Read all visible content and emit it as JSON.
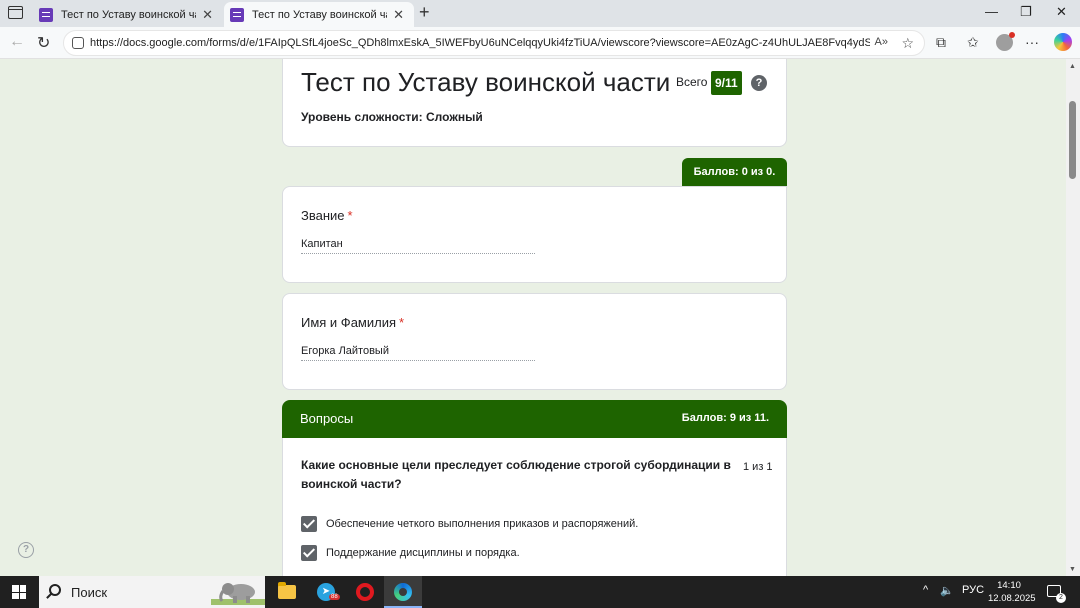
{
  "browser": {
    "tabs": [
      {
        "title": "Тест по Уставу воинской части",
        "active": false
      },
      {
        "title": "Тест по Уставу воинской части",
        "active": true
      }
    ],
    "url": "https://docs.google.com/forms/d/e/1FAIpQLSfL4joeSc_QDh8lmxEskA_5IWEFbyU6uNCelqqyUki4fzTiUA/viewscore?viewscore=AE0zAgC-z4UhULJAE8Fvq4ydSH...",
    "icons": [
      "window-menu-icon",
      "form-icon",
      "close-icon",
      "plus-icon",
      "back-icon",
      "refresh-icon",
      "lock-icon",
      "read-aloud-icon",
      "star-icon",
      "extensions-icon",
      "favorites-icon",
      "profile-icon",
      "more-icon",
      "copilot-icon"
    ]
  },
  "form": {
    "title": "Тест по Уставу воинской части",
    "total_label": "Всего",
    "total_score": "9/11",
    "difficulty": "Уровень сложности: Сложный",
    "points_pill": "Баллов: 0 из 0.",
    "fields": [
      {
        "label": "Звание",
        "required_mark": "*",
        "value": "Капитан"
      },
      {
        "label": "Имя и Фамилия",
        "required_mark": "*",
        "value": "Егорка Лайтовый"
      }
    ],
    "section": {
      "label": "Вопросы",
      "score": "Баллов: 9 из 11."
    },
    "question": {
      "text": "Какие основные цели преследует соблюдение строгой субординации в воинской части?",
      "score": "1 из 1",
      "options": [
        {
          "text": "Обеспечение четкого выполнения приказов и распоряжений.",
          "checked": true
        },
        {
          "text": "Поддержание дисциплины и порядка.",
          "checked": true
        }
      ]
    }
  },
  "taskbar": {
    "search_placeholder": "Поиск",
    "telegram_badge": "88",
    "language": "РУС",
    "time": "14:10",
    "date": "12.08.2025",
    "notification_count": "2"
  },
  "colors": {
    "accent": "#1e6400",
    "page_bg": "#e9f0e4",
    "required": "#d93025"
  }
}
